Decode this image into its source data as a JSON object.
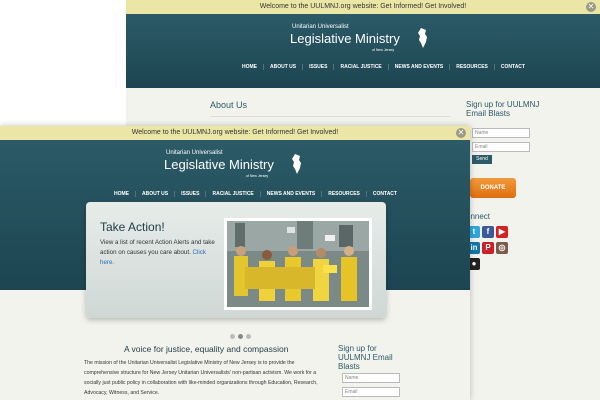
{
  "notice": {
    "text": "Welcome to the UULMNJ.org website: Get Informed! Get Involved!"
  },
  "logo": {
    "line1": "Unitarian Universalist",
    "line2": "Legislative Ministry",
    "line3": "of New Jersey"
  },
  "nav": [
    "HOME",
    "ABOUT US",
    "ISSUES",
    "RACIAL JUSTICE",
    "NEWS AND EVENTS",
    "RESOURCES",
    "CONTACT"
  ],
  "back_page": {
    "heading": "About Us"
  },
  "sidebar": {
    "signup_title": "Sign up for UULMNJ Email Blasts",
    "name_placeholder": "Name",
    "email_placeholder": "Email",
    "send_label": "Send",
    "donate_label": "DONATE",
    "connect_title": "onnect"
  },
  "slider": {
    "title": "Take Action!",
    "body": "View a list of recent Action Alerts and take action on causes you care about.",
    "link": "Click here."
  },
  "main": {
    "tagline": "A voice for justice, equality and compassion",
    "paragraph": "The mission of the Unitarian Universalist Legislative Ministry of New Jersey is to provide the comprehensive structure for New Jersey Unitarian Universalists' non-partisan activism.  We work for a socially just public policy in collaboration with like-minded organizations through Education, Research, Advocacy, Witness, and Service."
  },
  "colors": {
    "header": "#2c5a67",
    "notice": "#ece6a6",
    "donate": "#e8821f",
    "link": "#2a6ab8"
  }
}
